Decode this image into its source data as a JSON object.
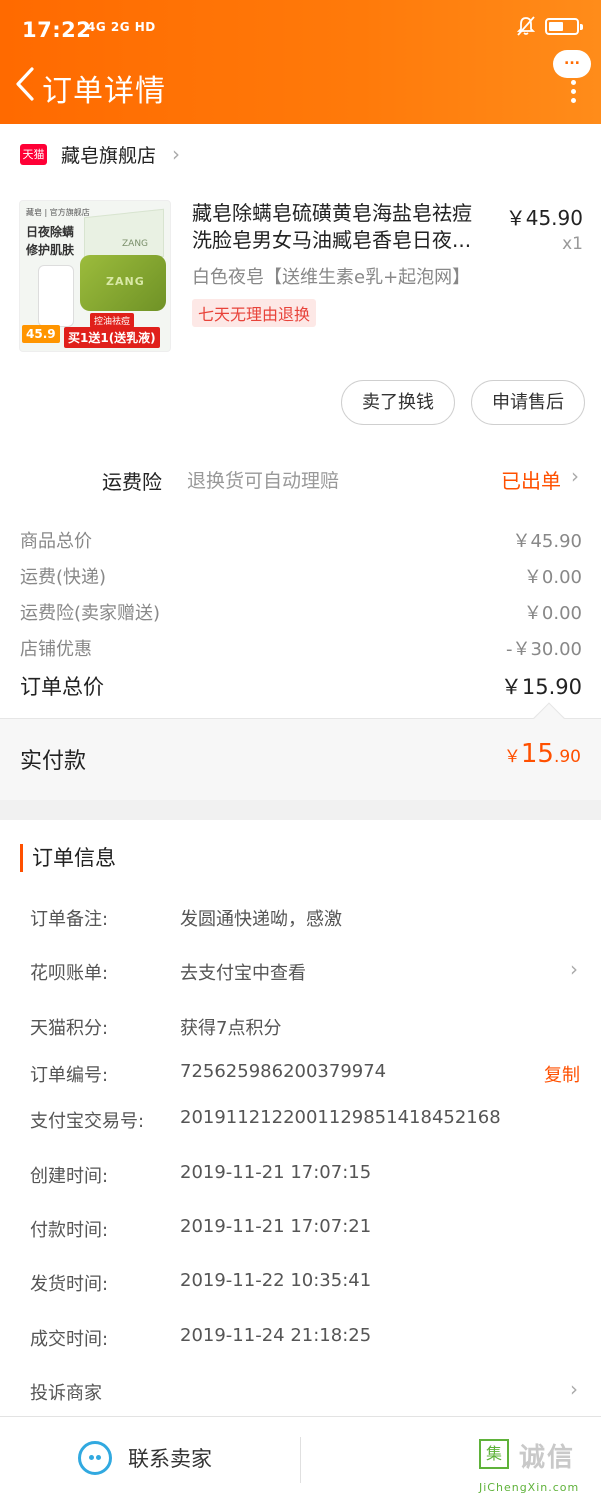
{
  "status_bar": {
    "time": "17:22",
    "signal": "4G 2G HD"
  },
  "nav": {
    "title": "订单详情",
    "more_bubble": "..."
  },
  "shop": {
    "platform_badge": "天猫",
    "name": "藏皂旗舰店"
  },
  "product": {
    "title_line1": "藏皂除螨皂硫磺黄皂海盐皂祛痘",
    "title_line2": "洗脸皂男女马油臧皂香皂日夜...",
    "price": "￥45.90",
    "quantity": "x1",
    "sku": "白色夜皂【送维生素e乳+起泡网】",
    "return_badge": "七天无理由退换",
    "image_texts": {
      "brand": "藏皂 | 官方旗舰店",
      "feature": "日夜除螨\n修护肌肤",
      "box_label": "ZANG",
      "soap_label": "ZANG",
      "tag": "控油祛痘",
      "price": "45.9",
      "promo": "买1送1(送乳液)"
    }
  },
  "actions": {
    "sell": "卖了换钱",
    "after_sale": "申请售后"
  },
  "insurance": {
    "label": "运费险",
    "description": "退换货可自动理赔",
    "status": "已出单"
  },
  "price_rows": [
    {
      "label": "商品总价",
      "value": "￥45.90"
    },
    {
      "label": "运费(快递)",
      "value": "￥0.00"
    },
    {
      "label": "运费险(卖家赠送)",
      "value": "￥0.00"
    },
    {
      "label": "店铺优惠",
      "value": "-￥30.00"
    }
  ],
  "order_total": {
    "label": "订单总价",
    "value": "￥15.90"
  },
  "paid": {
    "label": "实付款",
    "currency": "￥",
    "integer": "15",
    "decimal": ".90"
  },
  "order_info": {
    "title": "订单信息",
    "rows": [
      {
        "key": "订单备注:",
        "value": "发圆通快递呦，感激"
      },
      {
        "key": "花呗账单:",
        "value": "去支付宝中查看"
      },
      {
        "key": "天猫积分:",
        "value": "获得7点积分"
      },
      {
        "key": "订单编号:",
        "value": "725625986200379974",
        "action": "复制"
      },
      {
        "key": "支付宝交易号:",
        "value": "2019112122001129851418452168"
      },
      {
        "key": "创建时间:",
        "value": "2019-11-21 17:07:15"
      },
      {
        "key": "付款时间:",
        "value": "2019-11-21 17:07:21"
      },
      {
        "key": "发货时间:",
        "value": "2019-11-22 10:35:41"
      },
      {
        "key": "成交时间:",
        "value": "2019-11-24 21:18:25"
      },
      {
        "key": "投诉商家",
        "value": ""
      }
    ]
  },
  "bottom_bar": {
    "contact_label": "联系卖家"
  },
  "watermark": {
    "mark": "集",
    "text": "诚信",
    "url": "JiChengXin.com"
  },
  "colors": {
    "header_orange": "#ff6a00",
    "accent": "#ff5000",
    "tmall_red": "#ff0036",
    "contact_blue": "#31a9e0"
  },
  "icons": {
    "back": "chevron-left-icon",
    "more": "more-vertical-icon",
    "mute": "bell-off-icon",
    "battery": "battery-icon",
    "chevron": "chevron-right-icon",
    "contact": "smiley-chat-icon"
  }
}
